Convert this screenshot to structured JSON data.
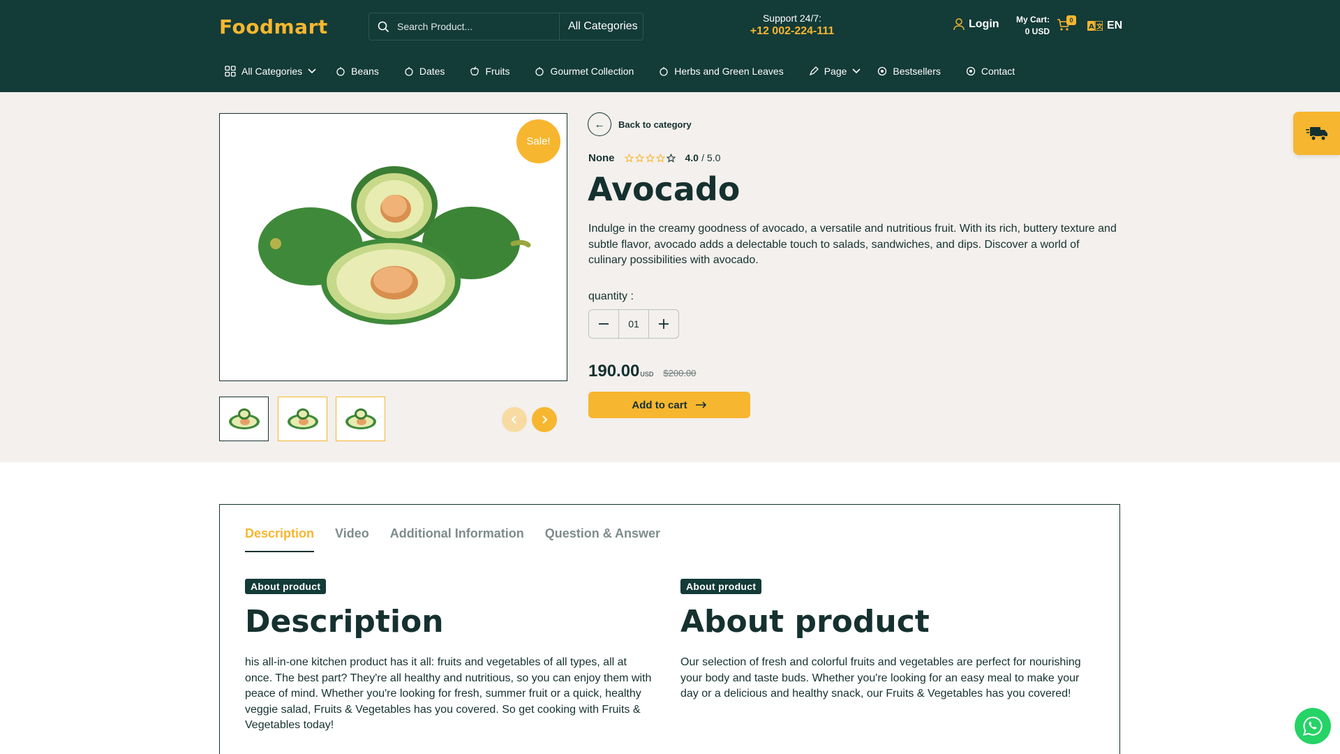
{
  "header": {
    "logo": "Foodmart",
    "search_placeholder": "Search Product...",
    "search_category": "All Categories",
    "support_label": "Support 24/7:",
    "support_phone": "+12 002-224-111",
    "login_label": "Login",
    "cart_label": "My Cart:",
    "cart_total": "0 USD",
    "cart_count": "0",
    "language": "EN"
  },
  "nav": {
    "items": [
      {
        "label": "All Categories",
        "icon": "grid-icon"
      },
      {
        "label": "Beans",
        "icon": "food-icon"
      },
      {
        "label": "Dates",
        "icon": "food-icon"
      },
      {
        "label": "Fruits",
        "icon": "apple-icon"
      },
      {
        "label": "Gourmet Collection",
        "icon": "food-icon"
      },
      {
        "label": "Herbs and Green Leaves",
        "icon": "food-icon"
      },
      {
        "label": "Page",
        "icon": "pen-icon"
      },
      {
        "label": "Bestsellers",
        "icon": "circle-icon"
      },
      {
        "label": "Contact",
        "icon": "circle-icon"
      }
    ]
  },
  "product": {
    "sale_badge": "Sale!",
    "back_label": "Back to category",
    "brand": "None",
    "rating": 4,
    "rating_value": "4.0",
    "rating_max": "/ 5.0",
    "title": "Avocado",
    "description": "Indulge in the creamy goodness of avocado, a versatile and nutritious fruit. With its rich, buttery texture and subtle flavor, avocado adds a delectable touch to salads, sandwiches, and dips. Discover a world of culinary possibilities with avocado.",
    "quantity_label": "quantity :",
    "quantity": "01",
    "price": "190.00",
    "currency": "USD",
    "old_price": "$200.00",
    "add_to_cart": "Add to cart"
  },
  "tabs": [
    "Description",
    "Video",
    "Additional Information",
    "Question & Answer"
  ],
  "description_section": {
    "pill": "About product",
    "title": "Description",
    "text": "his all-in-one kitchen product has it all: fruits and vegetables of all types, all at once. The best part? They're all healthy and nutritious, so you can enjoy them with peace of mind. Whether you're looking for fresh, summer fruit or a quick, healthy veggie salad, Fruits & Vegetables has you covered. So get cooking with Fruits & Vegetables today!"
  },
  "about_section": {
    "pill": "About product",
    "title": "About product",
    "text": "Our selection of fresh and colorful fruits and vegetables are perfect for nourishing your body and taste buds. Whether you're looking for an easy meal to make your day or a delicious and healthy snack, our Fruits & Vegetables has you covered!"
  },
  "colors": {
    "brand_dark": "#133b38",
    "accent": "#f7b62f",
    "product_bg": "#f3f0ed",
    "whatsapp": "#25d366"
  }
}
